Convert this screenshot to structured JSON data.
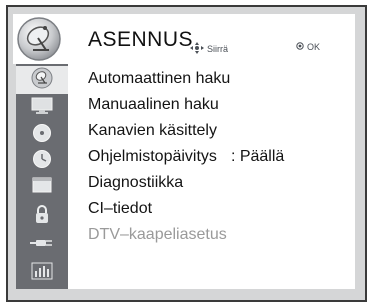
{
  "header": {
    "title": "ASENNUS",
    "hint_move": "Siirrä",
    "hint_ok": "OK",
    "icon": "satellite-dish-icon"
  },
  "sidebar": {
    "icons": [
      "satellite-dish-icon",
      "monitor-icon",
      "clock-icon",
      "clock-icon",
      "window-icon",
      "lock-icon",
      "plug-icon",
      "equalizer-icon"
    ],
    "active_index": 0
  },
  "menu": {
    "items": [
      {
        "label": "Automaattinen haku",
        "value": ""
      },
      {
        "label": "Manuaalinen haku",
        "value": ""
      },
      {
        "label": "Kanavien käsittely",
        "value": ""
      },
      {
        "label": "Ohjelmistopäivitys",
        "value": ": Päällä"
      },
      {
        "label": "Diagnostiikka",
        "value": ""
      },
      {
        "label": "CI–tiedot",
        "value": ""
      },
      {
        "label": "DTV–kaapeliasetus",
        "value": "",
        "disabled": true
      }
    ]
  },
  "colors": {
    "frame": "#d5d6d7",
    "sidebar": "#6a6c71",
    "panel": "#ffffff",
    "disabled_text": "#9a9a9a"
  }
}
